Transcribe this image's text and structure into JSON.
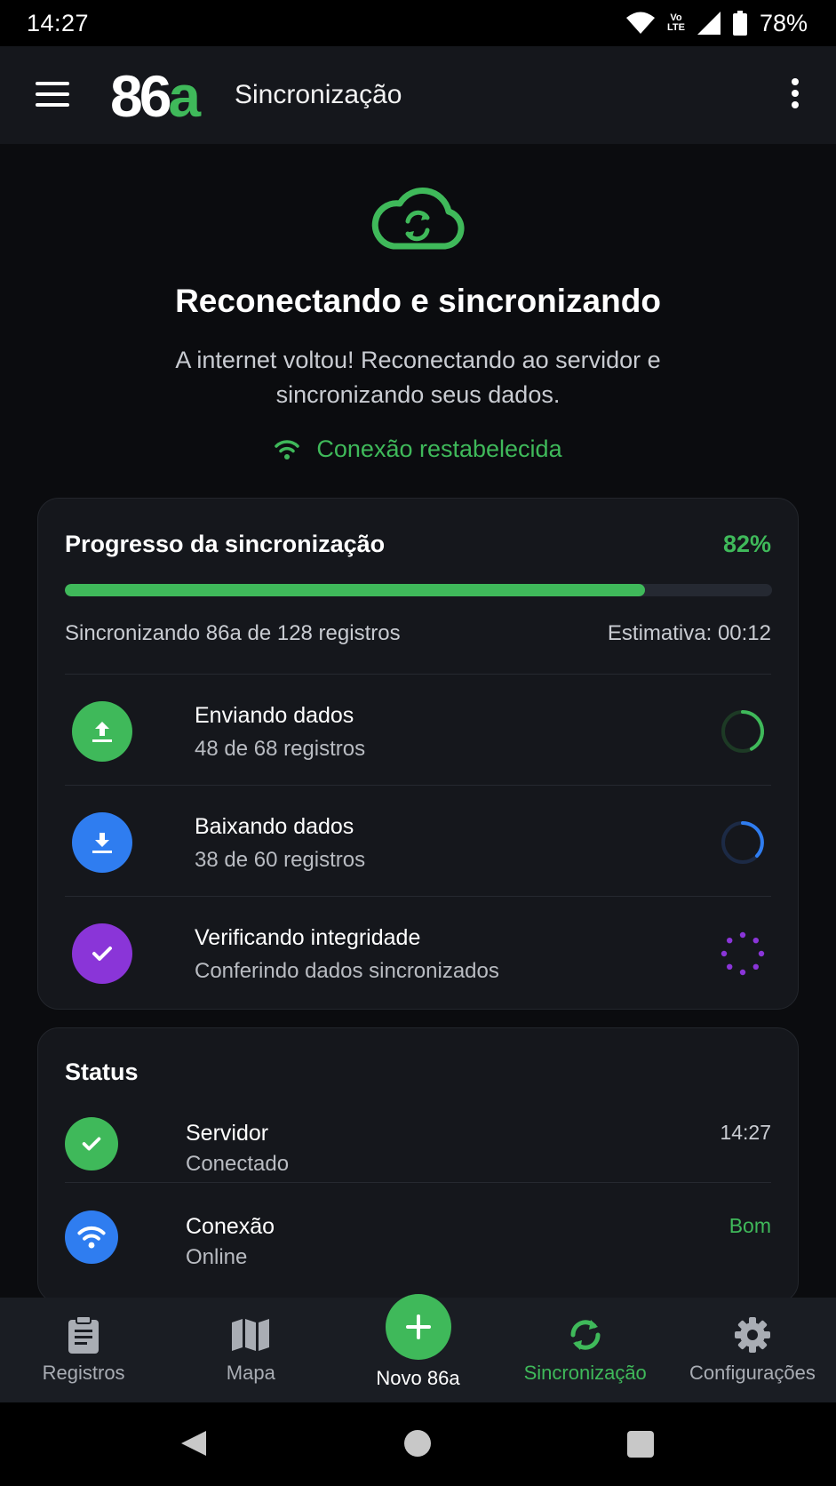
{
  "status_bar": {
    "time": "14:27",
    "network_label_top": "Vo",
    "network_label_bottom": "LTE",
    "battery": "78%"
  },
  "app_bar": {
    "logo_main": "86",
    "logo_accent": "a",
    "title": "Sincronização"
  },
  "hero": {
    "icon": "cloud-sync-icon",
    "title": "Reconectando e sincronizando",
    "subtitle": "A internet voltou! Reconectando ao servidor e sincronizando seus dados.",
    "connection_text": "Conexão restabelecida"
  },
  "progress": {
    "title": "Progresso da sincronização",
    "percent_label": "82%",
    "percent": 82,
    "detail": "Sincronizando 86a de 128 registros",
    "estimate": "Estimativa: 00:12",
    "tasks": [
      {
        "name": "Enviando dados",
        "sub": "48 de 68 registros",
        "icon": "upload-icon",
        "color": "#3fb95a"
      },
      {
        "name": "Baixando dados",
        "sub": "38 de 60 registros",
        "icon": "download-icon",
        "color": "#2f7df0"
      },
      {
        "name": "Verificando integridade",
        "sub": "Conferindo dados sincronizados",
        "icon": "check-icon",
        "color": "#8a35d8"
      }
    ]
  },
  "status": {
    "title": "Status",
    "rows": [
      {
        "name": "Servidor",
        "sub": "Conectado",
        "value": "14:27"
      },
      {
        "name": "Conexão",
        "sub": "Online",
        "value": "Bom"
      }
    ]
  },
  "bottom_nav": {
    "items": [
      {
        "label": "Registros",
        "icon": "clipboard-icon"
      },
      {
        "label": "Mapa",
        "icon": "map-icon"
      },
      {
        "label": "Novo 86a",
        "icon": "plus-icon"
      },
      {
        "label": "Sincronização",
        "icon": "sync-icon"
      },
      {
        "label": "Configurações",
        "icon": "gear-icon"
      }
    ]
  },
  "colors": {
    "accent": "#3fb95a",
    "blue": "#2f7df0",
    "purple": "#8a35d8",
    "background": "#0b0c0f",
    "card": "#15171c"
  }
}
